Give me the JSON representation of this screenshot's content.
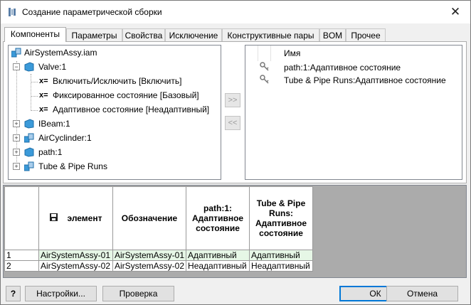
{
  "window": {
    "title": "Создание параметрической сборки",
    "close_glyph": "✕"
  },
  "tabs": [
    {
      "label": "Компоненты",
      "active": true
    },
    {
      "label": "Параметры"
    },
    {
      "label": "Свойства"
    },
    {
      "label": "Исключение"
    },
    {
      "label": "Конструктивные пары"
    },
    {
      "label": "BOM"
    },
    {
      "label": "Прочее"
    }
  ],
  "tree": {
    "root": "AirSystemAssy.iam",
    "items": [
      {
        "label": "Valve:1",
        "expander": "−",
        "icon": "part-icon"
      },
      {
        "label": "Включить/Исключить [Включить]",
        "prefix": "x="
      },
      {
        "label": "Фиксированное состояние [Базовый]",
        "prefix": "x="
      },
      {
        "label": "Адаптивное состояние [Неадаптивный]",
        "prefix": "x="
      },
      {
        "label": "IBeam:1",
        "expander": "+",
        "icon": "part-icon"
      },
      {
        "label": "AirCyclinder:1",
        "expander": "+",
        "icon": "assembly-icon"
      },
      {
        "label": "path:1",
        "expander": "+",
        "icon": "part-icon"
      },
      {
        "label": "Tube & Pipe Runs",
        "expander": "+",
        "icon": "assembly-icon"
      }
    ]
  },
  "move_buttons": {
    "add": ">>",
    "remove": "<<"
  },
  "right_list": {
    "header": "Имя",
    "items": [
      {
        "label": "path:1:Адаптивное состояние"
      },
      {
        "label": "Tube & Pipe Runs:Адаптивное состояние"
      }
    ]
  },
  "grid": {
    "headers": {
      "element": "элемент",
      "designation": "Обозначение",
      "col3": "path:1:\nАдаптивное\nсостояние",
      "col4": "Tube & Pipe\nRuns:\nАдаптивное\nсостояние"
    },
    "rows": [
      {
        "num": "1",
        "element": "AirSystemAssy-01",
        "designation": "AirSystemAssy-01",
        "c3": "Адаптивный",
        "c4": "Адаптивный"
      },
      {
        "num": "2",
        "element": "AirSystemAssy-02",
        "designation": "AirSystemAssy-02",
        "c3": "Неадаптивный",
        "c4": "Неадаптивный"
      }
    ]
  },
  "buttons": {
    "help": "?",
    "settings": "Настройки...",
    "check": "Проверка",
    "ok": "ОК",
    "cancel": "Отмена"
  },
  "colors": {
    "highlight_row": "#e6f7e6",
    "accent": "#0078d7",
    "icon_blue": "#3b9ad9"
  }
}
